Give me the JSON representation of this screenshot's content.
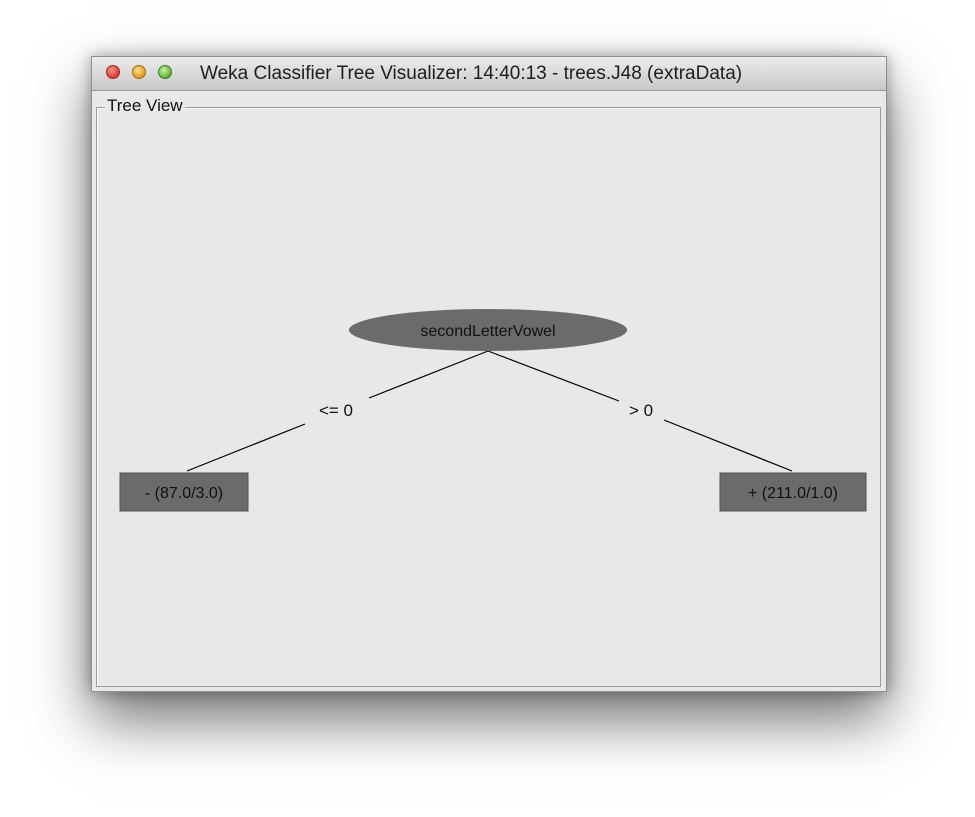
{
  "window": {
    "title": "Weka Classifier Tree Visualizer: 14:40:13 - trees.J48 (extraData)"
  },
  "panel": {
    "label": "Tree View"
  },
  "tree": {
    "root": {
      "label": "secondLetterVowel"
    },
    "edges": [
      {
        "label": "<= 0"
      },
      {
        "label": "> 0"
      }
    ],
    "leaves": [
      {
        "label": "- (87.0/3.0)"
      },
      {
        "label": "+ (211.0/1.0)"
      }
    ],
    "colors": {
      "node_fill": "#6b6b6b",
      "edge_stroke": "#000000"
    }
  }
}
